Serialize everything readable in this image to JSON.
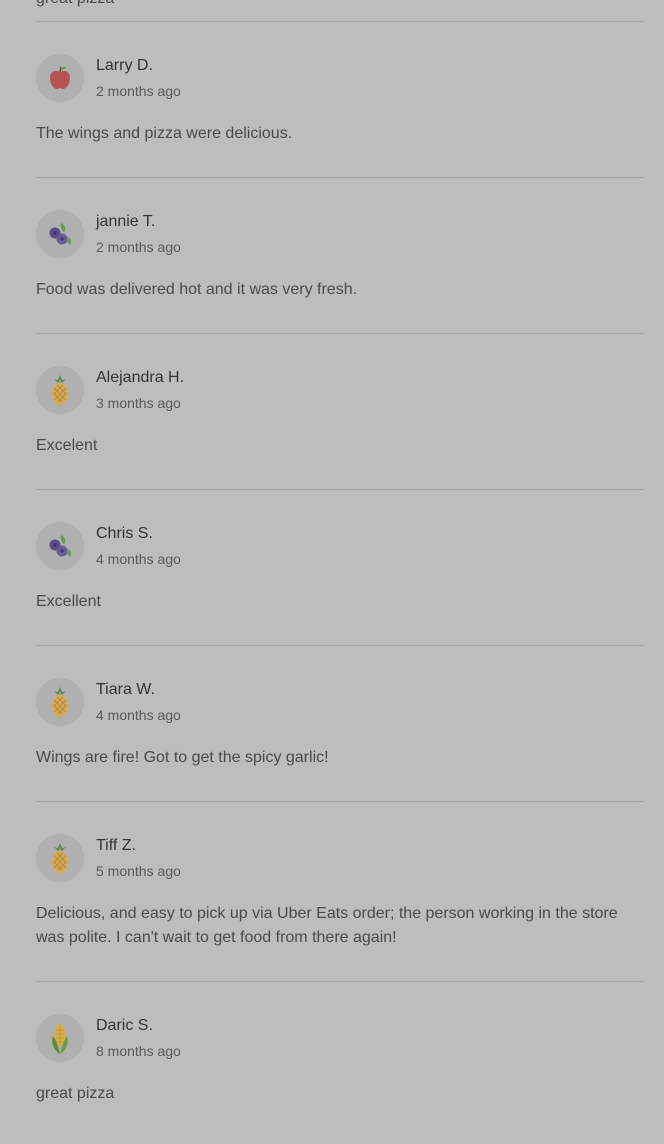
{
  "partial_top_review": {
    "text": "great pizza"
  },
  "reviews": [
    {
      "name": "Larry D.",
      "time": "2 months ago",
      "text": "The wings and pizza were delicious.",
      "avatar": "apple-icon"
    },
    {
      "name": "jannie T.",
      "time": "2 months ago",
      "text": "Food was delivered hot and it was very fresh.",
      "avatar": "blueberry-icon"
    },
    {
      "name": "Alejandra H.",
      "time": "3 months ago",
      "text": "Excelent",
      "avatar": "pineapple-icon"
    },
    {
      "name": "Chris S.",
      "time": "4 months ago",
      "text": "Excellent",
      "avatar": "blueberry-icon"
    },
    {
      "name": "Tiara W.",
      "time": "4 months ago",
      "text": "Wings are fire! Got to get the spicy garlic!",
      "avatar": "pineapple-icon"
    },
    {
      "name": "Tiff Z.",
      "time": "5 months ago",
      "text": "Delicious, and easy to pick up via Uber Eats order; the person working in the store was polite. I can't wait to get food from there again!",
      "avatar": "pineapple-icon"
    },
    {
      "name": "Daric S.",
      "time": "8 months ago",
      "text": "great pizza",
      "avatar": "corn-icon"
    }
  ],
  "colors": {
    "overlay_background": "#bdbdbd",
    "divider": "#a9a9a9",
    "avatar_bg": "#b0b0b0"
  }
}
